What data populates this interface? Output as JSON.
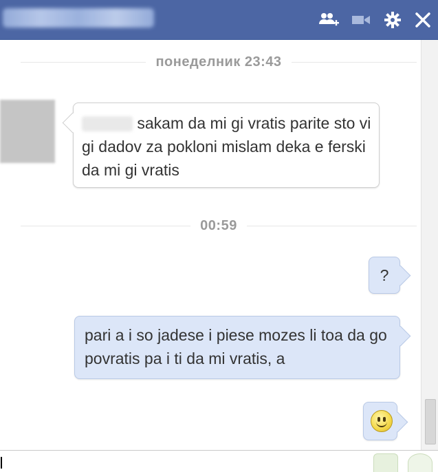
{
  "header": {
    "contact_name_blurred": true,
    "background": "#4c66a4",
    "icons": [
      "add-friend-icon",
      "video-call-icon",
      "settings-gear-icon",
      "close-icon"
    ]
  },
  "conversation": {
    "dividers": [
      {
        "label": "понеделник 23:43"
      },
      {
        "label": "00:59"
      }
    ],
    "messages": [
      {
        "from": "them",
        "text": "sakam da mi gi vratis parite sto vi gi dadov za pokloni mislam deka e ferski da mi gi vratis"
      },
      {
        "from": "me",
        "text": "?"
      },
      {
        "from": "me",
        "text": "pari a i so jadese i piese mozes li toa da go povratis pa i ti da mi vratis, a"
      },
      {
        "from": "me",
        "text": "",
        "emoji": "smiley-icon"
      }
    ]
  },
  "input": {
    "value": ""
  },
  "colors": {
    "accent": "#4c66a4",
    "my_bubble": "#dce6f8",
    "divider_text": "#9a9a9a"
  }
}
